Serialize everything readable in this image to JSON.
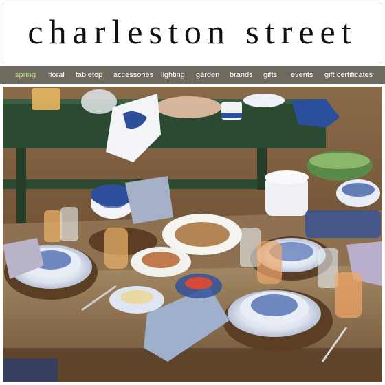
{
  "site": {
    "logo_text": "charleston street"
  },
  "nav": {
    "items": [
      {
        "label": "spring",
        "active": true
      },
      {
        "label": "floral",
        "active": false
      },
      {
        "label": "tabletop",
        "active": false
      },
      {
        "label": "accessories",
        "active": false
      },
      {
        "label": "lighting",
        "active": false
      },
      {
        "label": "garden",
        "active": false
      },
      {
        "label": "brands",
        "active": false
      },
      {
        "label": "gifts",
        "active": false
      },
      {
        "label": "events",
        "active": false
      },
      {
        "label": "gift certificates",
        "active": false
      }
    ]
  },
  "colors": {
    "nav_bg": "#6f6a60",
    "nav_active": "#b4db73",
    "nav_text": "#ffffff",
    "hutch_green": "#2c4a32",
    "table_wood": "#8a6a45",
    "china_blue": "#2d4f9c"
  }
}
